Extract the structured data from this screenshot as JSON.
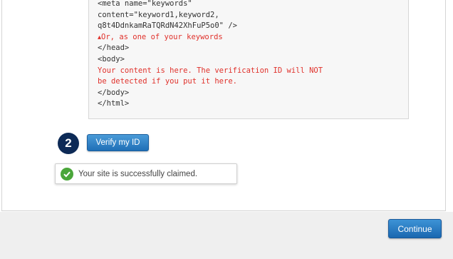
{
  "code": {
    "lines": [
      {
        "text": "<meta name=\"keywords\""
      },
      {
        "text": "content=\"keyword1,keyword2,"
      },
      {
        "text": "q8t4DdnkamRaTQRdN42XhFuP5o0\" />"
      },
      {
        "text": "Or, as one of your keywords",
        "pin_icon": "pin-icon"
      },
      {
        "text": "</head>"
      },
      {
        "text": "<body>"
      },
      {
        "text": "Your content is here. The verification ID will NOT"
      },
      {
        "text": "be detected if you put it here."
      },
      {
        "text": "</body>"
      },
      {
        "text": "</html>"
      }
    ],
    "highlight_color": "#e0312b"
  },
  "step": {
    "number": "2"
  },
  "verify_button": {
    "label": "Verify my ID"
  },
  "success_message": {
    "text": "Your site is successfully claimed.",
    "icon": "check-circle-icon",
    "color": "#4aa63a"
  },
  "footer": {
    "continue_label": "Continue"
  },
  "colors": {
    "accent": "#1f6fb7",
    "badge": "#0d2a56"
  }
}
